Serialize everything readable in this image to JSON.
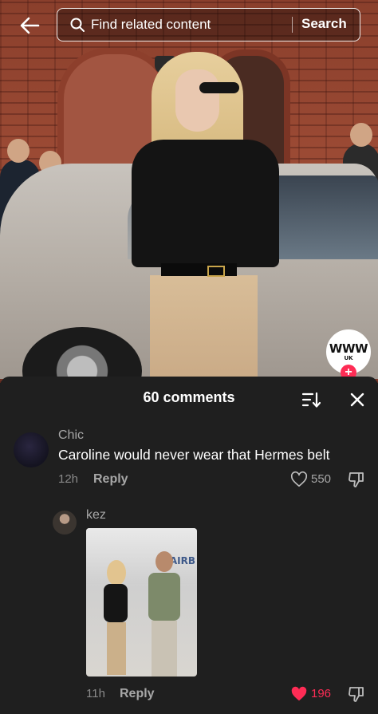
{
  "header": {
    "back_icon": "arrow-left-icon",
    "search": {
      "placeholder": "Find related content",
      "button_label": "Search"
    }
  },
  "video": {
    "creator_badge": {
      "logo_text": "WWW",
      "sub_text": "UK",
      "follow_symbol": "+"
    }
  },
  "comments_panel": {
    "title": "60 comments",
    "sort_icon": "sort-icon",
    "close_icon": "close-icon",
    "comments": [
      {
        "username": "Chic",
        "text": "Caroline would never wear that Hermes belt",
        "time": "12h",
        "reply_label": "Reply",
        "likes": "550",
        "liked": false
      },
      {
        "username": "kez",
        "text": "",
        "image_text": "AIRB",
        "time": "11h",
        "reply_label": "Reply",
        "likes": "196",
        "liked": true
      }
    ]
  },
  "colors": {
    "panel_bg": "#1f1f1f",
    "liked_red": "#fe2c55",
    "muted_text": "#a7a7a7"
  }
}
